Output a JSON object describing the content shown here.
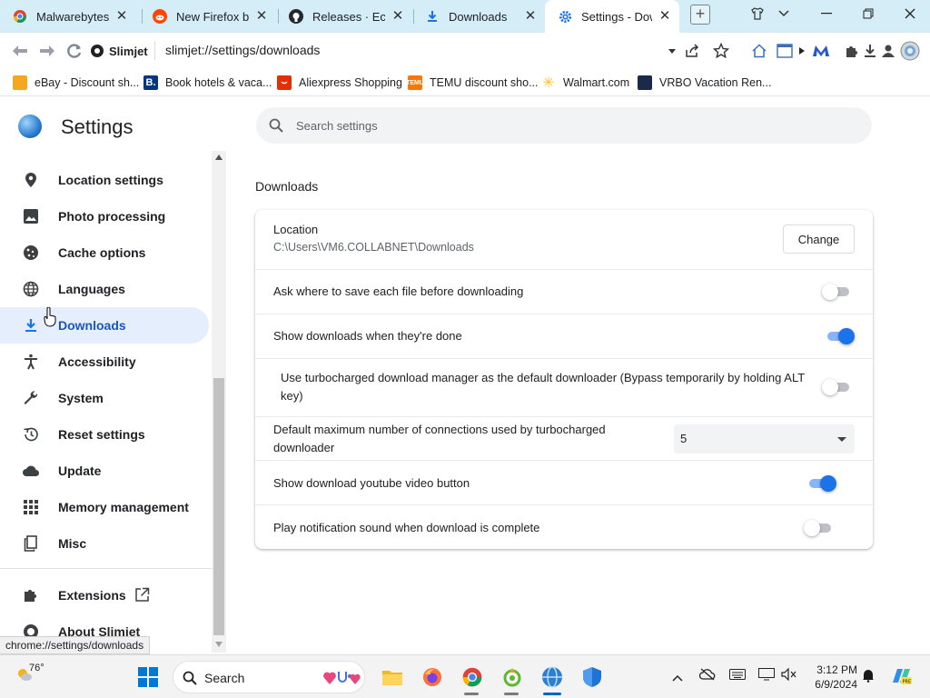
{
  "tabs": [
    {
      "title": "Malwarebytes",
      "active": false
    },
    {
      "title": "New Firefox ba",
      "active": false
    },
    {
      "title": "Releases · Eclip",
      "active": false
    },
    {
      "title": "Downloads",
      "active": false
    },
    {
      "title": "Settings - Dow",
      "active": true
    }
  ],
  "toolbar": {
    "site_badge": "Slimjet",
    "url": "slimjet://settings/downloads"
  },
  "bookmarks": [
    {
      "label": "eBay - Discount sh...",
      "icon": "shopping-bag-icon"
    },
    {
      "label": "Book hotels & vaca...",
      "icon": "booking-icon"
    },
    {
      "label": "Aliexpress Shopping",
      "icon": "aliexpress-icon"
    },
    {
      "label": "TEMU discount sho...",
      "icon": "temu-icon"
    },
    {
      "label": "Walmart.com",
      "icon": "walmart-icon"
    },
    {
      "label": "VRBO Vacation Ren...",
      "icon": "vrbo-icon"
    }
  ],
  "settings": {
    "title": "Settings",
    "search_placeholder": "Search settings",
    "sidebar": [
      {
        "label": "Location settings",
        "icon": "location-pin-icon"
      },
      {
        "label": "Photo processing",
        "icon": "image-icon"
      },
      {
        "label": "Cache options",
        "icon": "cookie-icon"
      },
      {
        "label": "Languages",
        "icon": "globe-icon"
      },
      {
        "label": "Downloads",
        "icon": "download-icon",
        "active": true
      },
      {
        "label": "Accessibility",
        "icon": "accessibility-icon"
      },
      {
        "label": "System",
        "icon": "wrench-icon"
      },
      {
        "label": "Reset settings",
        "icon": "history-icon"
      },
      {
        "label": "Update",
        "icon": "cloud-icon"
      },
      {
        "label": "Memory management",
        "icon": "grid-icon"
      },
      {
        "label": "Misc",
        "icon": "copy-icon"
      }
    ],
    "extensions_label": "Extensions",
    "about_label": "About Slimjet",
    "section_title": "Downloads",
    "location": {
      "label": "Location",
      "path": "C:\\Users\\VM6.COLLABNET\\Downloads",
      "change_button": "Change"
    },
    "ask_where": {
      "label": "Ask where to save each file before downloading",
      "enabled": false
    },
    "show_done": {
      "label": "Show downloads when they're done",
      "enabled": true
    },
    "turbo": {
      "label": "Use turbocharged download manager as the default downloader (Bypass temporarily by holding ALT key)",
      "enabled": false
    },
    "connections": {
      "label": "Default maximum number of connections used by turbocharged downloader",
      "value": "5"
    },
    "youtube": {
      "label": "Show download youtube video button",
      "enabled": true
    },
    "sound": {
      "label": "Play notification sound when download is complete",
      "enabled": false
    }
  },
  "status_url": "chrome://settings/downloads",
  "taskbar": {
    "temperature": "76°",
    "search_label": "Search",
    "time": "3:12 PM",
    "date": "6/9/2024"
  },
  "colors": {
    "accent": "#1a73e8",
    "tabstrip": "#d4edf7",
    "active_nav_bg": "#e4eefc"
  }
}
